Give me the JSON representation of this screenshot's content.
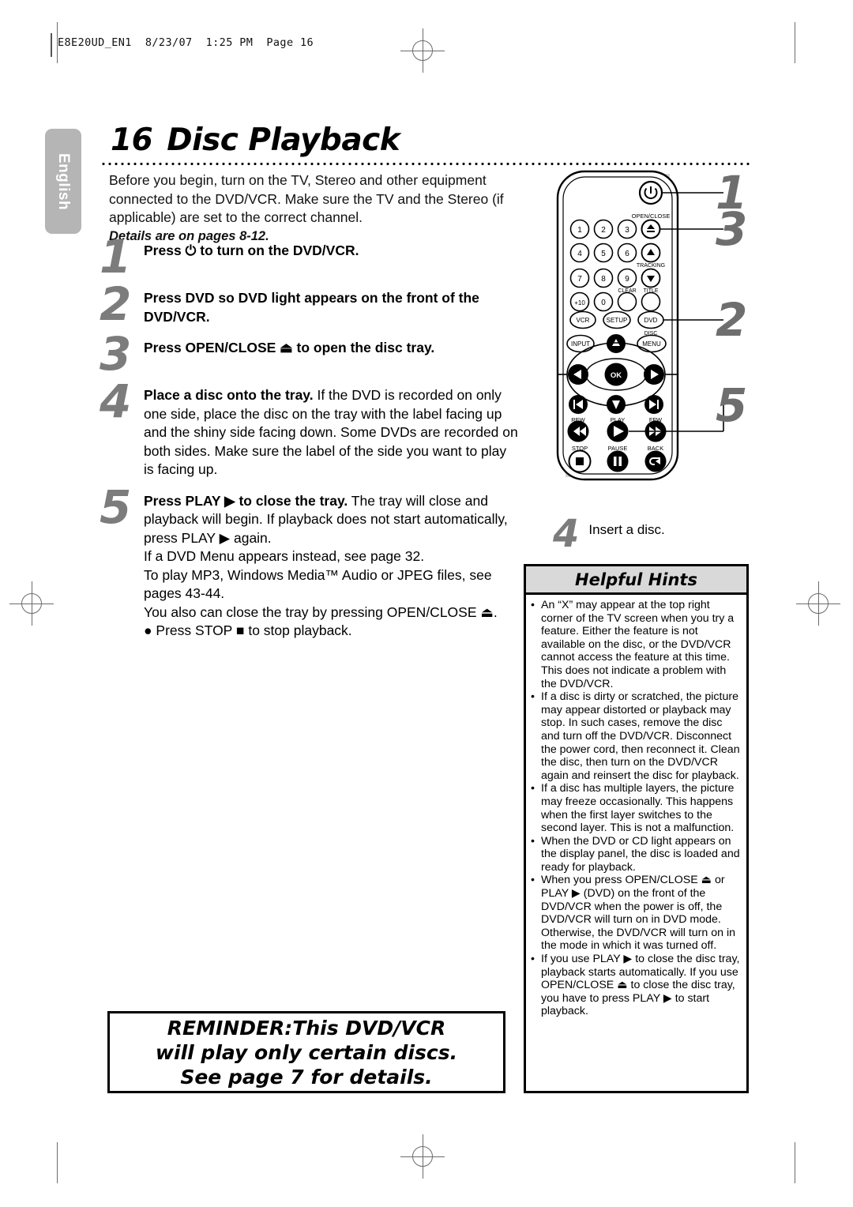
{
  "print_header": {
    "text": "E8E20UD_EN1  8/23/07  1:25 PM  Page 16"
  },
  "language_tab": {
    "label": "English"
  },
  "page_title": {
    "number": "16",
    "text": "Disc Playback"
  },
  "intro": {
    "paragraph": "Before you begin, turn on the TV, Stereo and other equipment connected to the DVD/VCR. Make sure the TV and the Stereo (if applicable) are set to the correct channel.",
    "details_note": "Details are on pages 8-12."
  },
  "steps": [
    {
      "number": "1",
      "bold_lead": "Press ⏻ to turn on the DVD/VCR.",
      "rest": ""
    },
    {
      "number": "2",
      "bold_lead": "Press DVD so DVD light appears on the front of the DVD/VCR.",
      "rest": ""
    },
    {
      "number": "3",
      "bold_lead": "Press OPEN/CLOSE ⏏ to open the disc tray.",
      "rest": ""
    },
    {
      "number": "4",
      "bold_lead": "Place a disc onto the tray.",
      "rest": " If the DVD is recorded on only one side, place the disc on the tray with the label facing up and the shiny side facing down. Some DVDs are recorded on both sides. Make sure the label of the side you want to play is facing up."
    },
    {
      "number": "5",
      "bold_lead": "Press PLAY ▶ to close the tray.",
      "rest": " The tray will close and playback will begin. If playback does not start automatically, press PLAY ▶ again.\nIf a DVD Menu appears instead, see page 32.\nTo play MP3, Windows Media™ Audio or JPEG files, see pages 43-44.\nYou also can close the tray by pressing OPEN/CLOSE ⏏.\n● Press STOP ■ to stop playback."
    }
  ],
  "reminder": {
    "line1": "REMINDER:This DVD/VCR",
    "line2": "will play only certain discs.",
    "line3": "See page 7 for details."
  },
  "remote": {
    "callouts": [
      {
        "label": "1",
        "target": "power-button"
      },
      {
        "label": "3",
        "target": "open-close-button"
      },
      {
        "label": "2",
        "target": "dvd-button"
      },
      {
        "label": "5",
        "target": "play-button"
      }
    ],
    "labels": {
      "open_close": "OPEN/CLOSE",
      "tracking": "TRACKING",
      "clear": "CLEAR",
      "title": "TITLE",
      "vcr": "VCR",
      "setup": "SETUP",
      "dvd": "DVD",
      "disc": "DISC",
      "menu": "MENU",
      "input": "INPUT",
      "ok": "OK",
      "rew": "REW",
      "play": "PLAY",
      "ffw": "FFW",
      "stop": "STOP",
      "pause": "PAUSE",
      "back": "BACK"
    },
    "keypad": [
      "1",
      "2",
      "3",
      "4",
      "5",
      "6",
      "7",
      "8",
      "9",
      "+10",
      "0"
    ]
  },
  "insert_note": {
    "number": "4",
    "text": "Insert a disc."
  },
  "hints": {
    "title": "Helpful Hints",
    "items": [
      "An “X” may appear at the top right corner of the TV screen when you try a feature. Either the feature is not available on the disc, or the DVD/VCR cannot access the feature at this time. This does not indicate a problem with the DVD/VCR.",
      "If a disc is dirty or scratched, the picture may appear distorted or playback may stop. In such cases, remove the disc and turn off the DVD/VCR. Disconnect the power cord, then reconnect it. Clean the disc, then turn on the DVD/VCR again and reinsert the disc for playback.",
      "If a disc has multiple layers, the picture may freeze occasionally. This happens when the first layer switches to the second layer. This is not a malfunction.",
      "When the DVD or CD light appears on the display panel, the disc is loaded and ready for playback.",
      "When you press OPEN/CLOSE ⏏ or PLAY ▶ (DVD) on the front of the DVD/VCR when the power is off, the DVD/VCR will turn on in DVD mode. Otherwise, the DVD/VCR will turn on in the mode in which it was turned off.",
      "If you use PLAY ▶ to close the disc tray, playback starts automatically. If you use OPEN/CLOSE ⏏ to close the disc tray, you have to press PLAY ▶ to start playback."
    ]
  },
  "colors": {
    "callout_gray": "#6e6e6e",
    "tab_gray": "#b5b5b5",
    "hints_header_gray": "#d9d9d9",
    "highlight_gray": "#d5d5d5"
  }
}
